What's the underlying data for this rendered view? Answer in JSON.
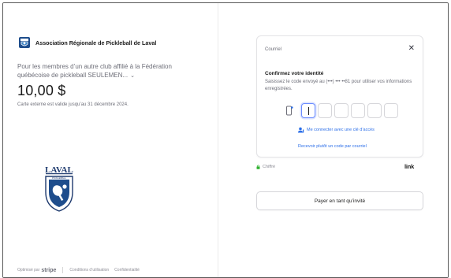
{
  "merchant": {
    "name": "Association Régionale de Pickleball de Laval",
    "logo_icon": "club-shield-icon",
    "brand_color": "#1e4d8c"
  },
  "product": {
    "description": "Pour les membres d’un autre club affilié à la Fédération québécoise de pickleball SEULEMEN...",
    "price": "10,00 $",
    "note": "Carte externe est valide jusqu’au 31 décembre 2024."
  },
  "club_logo": {
    "text": "LAVAL",
    "ring_text": "PICKLEBALL",
    "icon": "pickleball-paddle-icon"
  },
  "footer": {
    "powered_prefix": "Optimisé par",
    "powered_brand": "stripe",
    "terms": "Conditions d’utilisation",
    "privacy": "Confidentialité"
  },
  "verify": {
    "header": "Courriel",
    "title": "Confirmez votre identité",
    "description": "Saisissez le code envoyé au (•••) ••• ••81 pour utiliser vos informations enregistrées.",
    "code_boxes": 6,
    "passkey_label": "Me connecter avec une clé d’accès",
    "alt_label": "Recevoir plutôt un code par courriel",
    "accent_color": "#2b6ee8"
  },
  "security": {
    "secured_label": "Chiffré",
    "link_brand": "link"
  },
  "guest": {
    "label": "Payer en tant qu’invité"
  }
}
